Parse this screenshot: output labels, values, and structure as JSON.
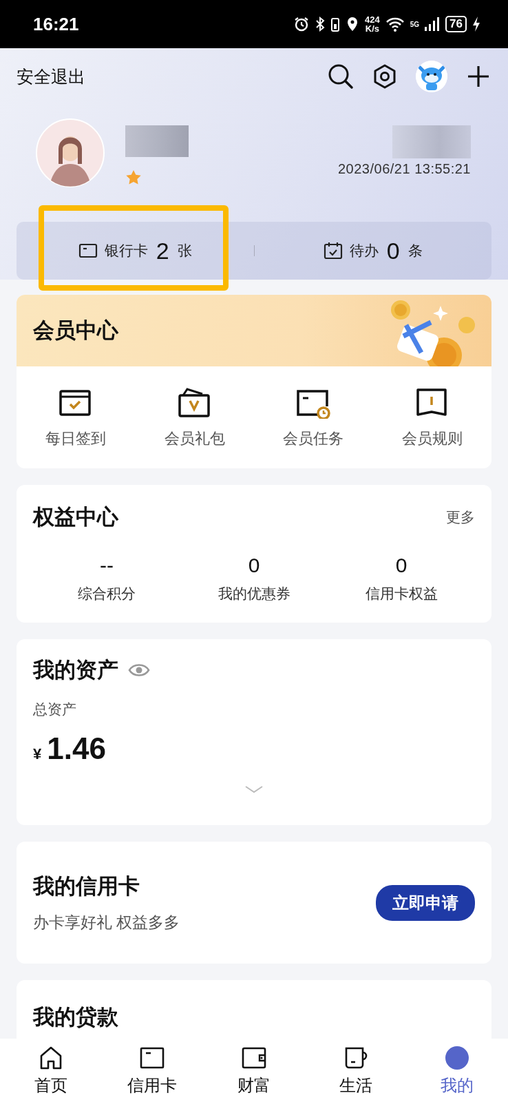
{
  "status_bar": {
    "time": "16:21",
    "net_speed": "424",
    "net_unit": "K/s",
    "network": "5G",
    "battery": "76"
  },
  "header": {
    "logout": "安全退出"
  },
  "profile": {
    "timestamp": "2023/06/21 13:55:21"
  },
  "summary": [
    {
      "label": "银行卡",
      "count": "2",
      "unit": "张",
      "highlighted": true
    },
    {
      "label": "待办",
      "count": "0",
      "unit": "条",
      "highlighted": false
    }
  ],
  "member_center": {
    "title": "会员中心",
    "items": [
      {
        "label": "每日签到"
      },
      {
        "label": "会员礼包"
      },
      {
        "label": "会员任务"
      },
      {
        "label": "会员规则"
      }
    ]
  },
  "rights_center": {
    "title": "权益中心",
    "more": "更多",
    "stats": [
      {
        "value": "--",
        "label": "综合积分"
      },
      {
        "value": "0",
        "label": "我的优惠券"
      },
      {
        "value": "0",
        "label": "信用卡权益"
      }
    ]
  },
  "assets": {
    "title": "我的资产",
    "total_label": "总资产",
    "currency": "¥",
    "amount": "1.46"
  },
  "credit_card": {
    "title": "我的信用卡",
    "subtitle": "办卡享好礼 权益多多",
    "button": "立即申请"
  },
  "loans": {
    "title": "我的贷款"
  },
  "nav": [
    {
      "label": "首页",
      "selected": false
    },
    {
      "label": "信用卡",
      "selected": false
    },
    {
      "label": "财富",
      "selected": false
    },
    {
      "label": "生活",
      "selected": false
    },
    {
      "label": "我的",
      "selected": true
    }
  ]
}
